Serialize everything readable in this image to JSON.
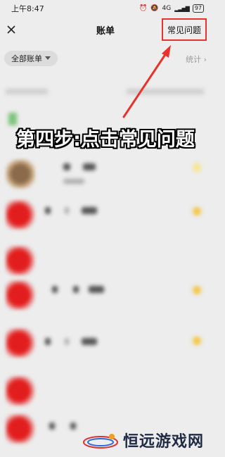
{
  "status_bar": {
    "time": "上午8:47",
    "network": "4G",
    "battery": "97"
  },
  "header": {
    "title": "账单",
    "close_icon": "close-icon",
    "faq_label": "常见问题"
  },
  "filter": {
    "chip_label": "全部账单",
    "chip_icon": "caret-down-icon",
    "stats_label": "统计"
  },
  "annotation": {
    "step_text": "第四步:点击常见问题",
    "arrow_color": "#e8322b"
  },
  "watermark": {
    "text": "恒远游戏网"
  },
  "colors": {
    "background": "#ededed",
    "highlight": "#e8322b"
  }
}
